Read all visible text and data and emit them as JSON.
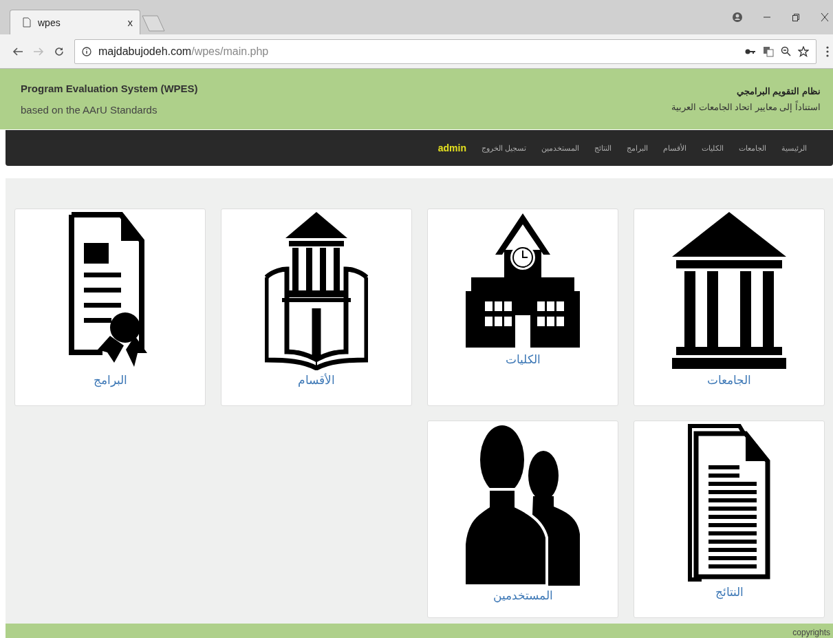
{
  "browser": {
    "tab_title": "wpes",
    "close_tab": "x",
    "url_host": "majdabujodeh.com",
    "url_path": "/wpes/main.php"
  },
  "header": {
    "title": "Program Evaluation System (WPES)",
    "subtitle": "based on the AArU Standards",
    "title_ar": "نظام التقويم البرامجي",
    "subtitle_ar": "استناداً إلى معايير اتحاد الجامعات العربية"
  },
  "nav": {
    "items": [
      "الرئيسية",
      "الجامعات",
      "الكليات",
      "الأقسام",
      "البرامج",
      "النتائج",
      "المستخدمين",
      "تسجيل الخروج"
    ],
    "user": "admin"
  },
  "cards": [
    {
      "label": "الجامعات",
      "kind": "university"
    },
    {
      "label": "الكليات",
      "kind": "college"
    },
    {
      "label": "الأقسام",
      "kind": "department"
    },
    {
      "label": "البرامج",
      "kind": "program"
    },
    {
      "label": "النتائج",
      "kind": "results"
    },
    {
      "label": "المستخدمين",
      "kind": "users"
    }
  ],
  "footer": {
    "text": "copyrights"
  }
}
